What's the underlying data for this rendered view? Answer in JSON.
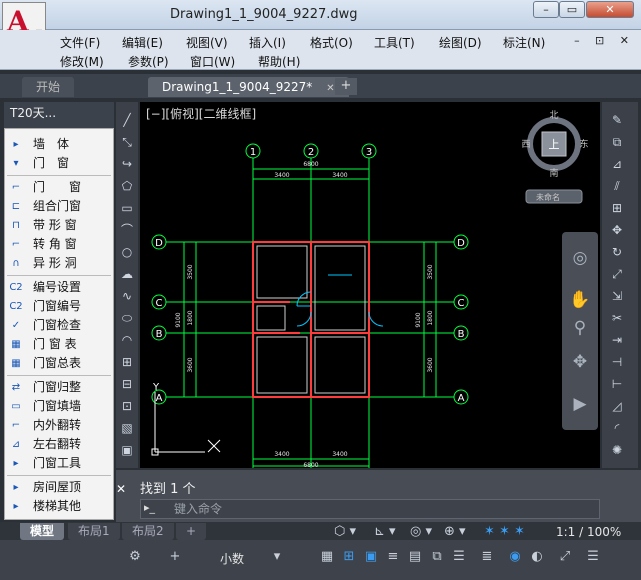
{
  "window": {
    "title": "Drawing1_1_9004_9227.dwg",
    "app_letter": "A",
    "buttons": {
      "minimize": "–",
      "restore": "▭",
      "close": "✕"
    }
  },
  "menu": {
    "row1": [
      "文件(F)",
      "编辑(E)",
      "视图(V)",
      "插入(I)",
      "格式(O)",
      "工具(T)",
      "绘图(D)",
      "标注(N)"
    ],
    "row2": [
      "修改(M)",
      "参数(P)",
      "窗口(W)",
      "帮助(H)"
    ],
    "doc_controls": "– ⊡ ✕"
  },
  "tabs": {
    "start": "开始",
    "drawing": "Drawing1_1_9004_9227*",
    "close": "✕",
    "add": "+"
  },
  "palette": {
    "header": "T20天...",
    "items": [
      {
        "icon": "▸",
        "label": "墙　体",
        "group": true
      },
      {
        "icon": "▾",
        "label": "门　窗",
        "group": true
      },
      {
        "icon": "⌐",
        "label": "门　　窗"
      },
      {
        "icon": "⊏",
        "label": "组合门窗"
      },
      {
        "icon": "⊓",
        "label": "带 形 窗"
      },
      {
        "icon": "⌐",
        "label": "转 角 窗"
      },
      {
        "icon": "∩",
        "label": "异 形 洞"
      },
      {
        "icon": "C2",
        "label": "编号设置"
      },
      {
        "icon": "C2",
        "label": "门窗编号"
      },
      {
        "icon": "✓",
        "label": "门窗检查"
      },
      {
        "icon": "▦",
        "label": "门 窗 表"
      },
      {
        "icon": "▦",
        "label": "门窗总表"
      },
      {
        "icon": "⇄",
        "label": "门窗归整"
      },
      {
        "icon": "▭",
        "label": "门窗填墙"
      },
      {
        "icon": "⌐",
        "label": "内外翻转"
      },
      {
        "icon": "⊿",
        "label": "左右翻转"
      },
      {
        "icon": "▸",
        "label": "门窗工具",
        "group": true
      },
      {
        "icon": "▸",
        "label": "房间屋顶",
        "group": true
      },
      {
        "icon": "▸",
        "label": "楼梯其他",
        "group": true
      }
    ]
  },
  "viewport": {
    "label": "[−][俯视][二维线框]",
    "viewcube": {
      "north": "北",
      "south": "南",
      "east": "东",
      "west": "西",
      "top": "上",
      "wcs": "未命名"
    }
  },
  "plan": {
    "axes_top": [
      "1",
      "2",
      "3"
    ],
    "axes_side": [
      "D",
      "C",
      "B",
      "A"
    ],
    "dims": {
      "total_top": "6800",
      "top_left": "3400",
      "top_right": "3400",
      "bottom_left": "3400",
      "bottom_right": "3400",
      "left_seg_1": "3500",
      "left_seg_2": "1800",
      "left_seg_3": "3600",
      "left_total": "9100",
      "right_seg_1": "3500",
      "right_seg_2": "1800",
      "right_seg_3": "3600",
      "right_total": "9100",
      "bottom_total": "6800"
    }
  },
  "command": {
    "close": "✕",
    "history": "找到 1 个",
    "prompt_icon": "▸_",
    "placeholder": "键入命令"
  },
  "layout_tabs": [
    "模型",
    "布局1",
    "布局2",
    "+"
  ],
  "status": {
    "scale": "1:1 / 100%",
    "text_size": "小数",
    "icons": [
      "gear-icon",
      "plus-icon",
      "grid-icon",
      "snap-icon",
      "ortho-icon",
      "polar-icon",
      "osnap-icon",
      "annotation-icon",
      "workspace-icon",
      "lock-icon",
      "fullscreen-icon",
      "menu-icon"
    ]
  },
  "colors": {
    "axis_green": "#00ff3c",
    "wall_red": "#ff3b3b",
    "dim_white": "#e8e8e8",
    "accent_blue": "#3b9cf0"
  }
}
